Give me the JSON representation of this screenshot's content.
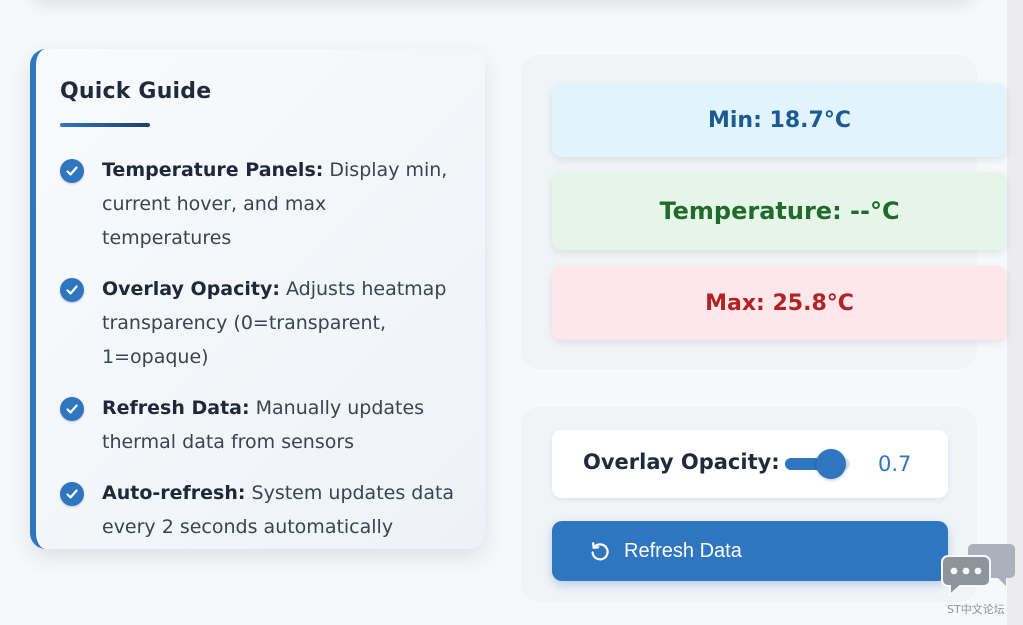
{
  "guide": {
    "title": "Quick Guide",
    "items": [
      {
        "term": "Temperature Panels:",
        "desc": " Display min, current hover, and max temperatures"
      },
      {
        "term": "Overlay Opacity:",
        "desc": " Adjusts heatmap transparency (0=transparent, 1=opaque)"
      },
      {
        "term": "Refresh Data:",
        "desc": " Manually updates thermal data from sensors"
      },
      {
        "term": "Auto-refresh:",
        "desc": " System updates data every 2 seconds automatically"
      }
    ]
  },
  "temperature": {
    "min": "Min: 18.7°C",
    "current": "Temperature: --°C",
    "max": "Max: 25.8°C",
    "colors": {
      "min_bg": "#e1f3fd",
      "current_bg": "#e6f5ea",
      "max_bg": "#fde7ea"
    }
  },
  "controls": {
    "opacity_label": "Overlay Opacity:",
    "opacity_value": "0.7",
    "opacity_level": 0.7,
    "refresh_label": "Refresh Data",
    "refresh_icon": "refresh-icon"
  },
  "accent_color": "#2e76c0",
  "watermark": {
    "text": "ST中文论坛",
    "icon": "chat-bubbles-icon"
  }
}
